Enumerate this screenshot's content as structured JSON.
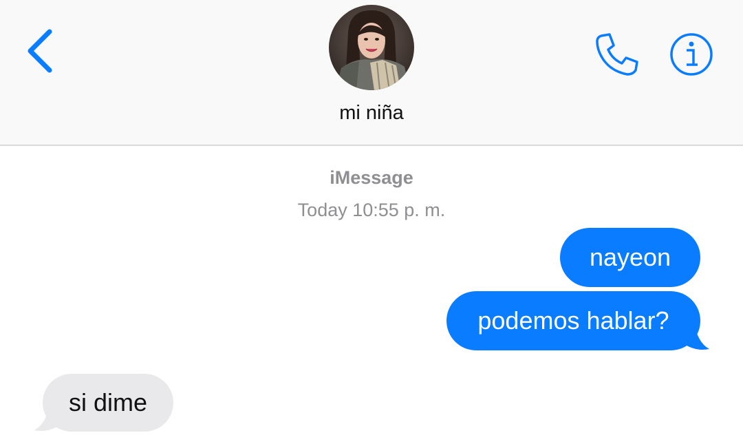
{
  "header": {
    "contact_name": "mi niña",
    "back_icon": "chevron-left-icon",
    "call_icon": "phone-icon",
    "info_icon": "info-icon",
    "accent_color": "#0a7cff"
  },
  "conversation": {
    "service": "iMessage",
    "timestamp": "Today 10:55 p. m.",
    "messages": [
      {
        "direction": "sent",
        "text": "nayeon"
      },
      {
        "direction": "sent",
        "text": "podemos hablar?"
      },
      {
        "direction": "received",
        "text": "si dime"
      }
    ]
  },
  "colors": {
    "sent_bubble": "#0a7cff",
    "received_bubble": "#e9e9eb",
    "meta_text": "#8e8e93",
    "header_bg": "#f9f9f9"
  }
}
